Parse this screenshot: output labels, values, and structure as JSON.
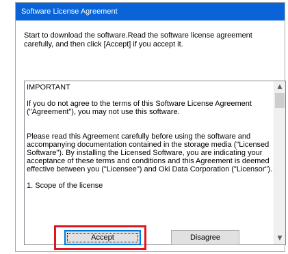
{
  "window": {
    "title": "Software License Agreement"
  },
  "intro_text": "Start to download the software.Read the software license agreement carefully, and then click [Accept] if you accept it.",
  "license": {
    "paragraphs": [
      "IMPORTANT",
      "If you do not agree to the terms of this Software License Agreement (\"Agreement\"), you may not use this software.",
      "Please read this Agreement carefully before using the software and accompanying documentation contained in the storage media (\"Licensed Software\"). By installing the Licensed Software, you are indicating your acceptance of these terms and conditions and this Agreement is deemed effective between you (\"Licensee\") and Oki Data Corporation (\"Licensor\").",
      "1. Scope of the license"
    ]
  },
  "scrollbar": {
    "up_icon": "▲",
    "down_icon": "▼"
  },
  "buttons": {
    "accept_label": "Accept",
    "disagree_label": "Disagree"
  },
  "colors": {
    "titlebar": "#0a64d8",
    "highlight": "#e3141e",
    "focus_border": "#0078d7"
  }
}
